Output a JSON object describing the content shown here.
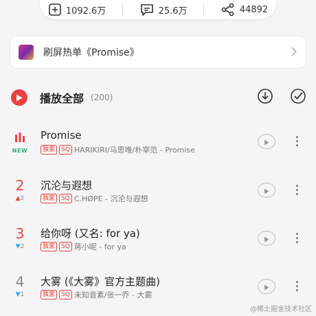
{
  "stats": {
    "collect_count": "1092.6万",
    "comment_count": "25.6万",
    "share_count": "44892"
  },
  "banner": {
    "text": "刷屏热单《Promise》"
  },
  "play_all": {
    "label": "播放全部",
    "count": "(200)"
  },
  "songs": [
    {
      "rank": "",
      "rank_change": "NEW",
      "title": "Promise",
      "tags": [
        "独家",
        "SQ"
      ],
      "subtitle": "HARIKIRI/马思唯/朴宰范 - Promise"
    },
    {
      "rank": "2",
      "rank_change_arrow": "▲",
      "rank_change": "2",
      "title": "沉沦与遐想",
      "tags": [
        "独家",
        "SQ"
      ],
      "subtitle": "C.HØPE - 沉沦与遐想"
    },
    {
      "rank": "3",
      "rank_change_arrow": "▼",
      "rank_change": "2",
      "title": "给你呀 (又名: for ya)",
      "tags": [
        "独家",
        "SQ"
      ],
      "subtitle": "蒋小呢 - for ya"
    },
    {
      "rank": "4",
      "rank_change_arrow": "▼",
      "rank_change": "1",
      "title": "大雾 (《大雾》官方主题曲)",
      "tags": [
        "独家",
        "SQ"
      ],
      "subtitle": "未知音素/张一乔 - 大雾"
    }
  ],
  "watermark": "@稀土掘金技术社区",
  "colors": {
    "accent": "#ec4141",
    "new_badge": "#2cae6f",
    "down_arrow": "#3ca9e0"
  },
  "icons": [
    "add-collect-icon",
    "comment-icon",
    "share-icon",
    "play-icon",
    "download-icon",
    "multi-select-icon",
    "playing-bars-icon",
    "mv-play-icon",
    "more-icon",
    "chevron-right-icon"
  ]
}
